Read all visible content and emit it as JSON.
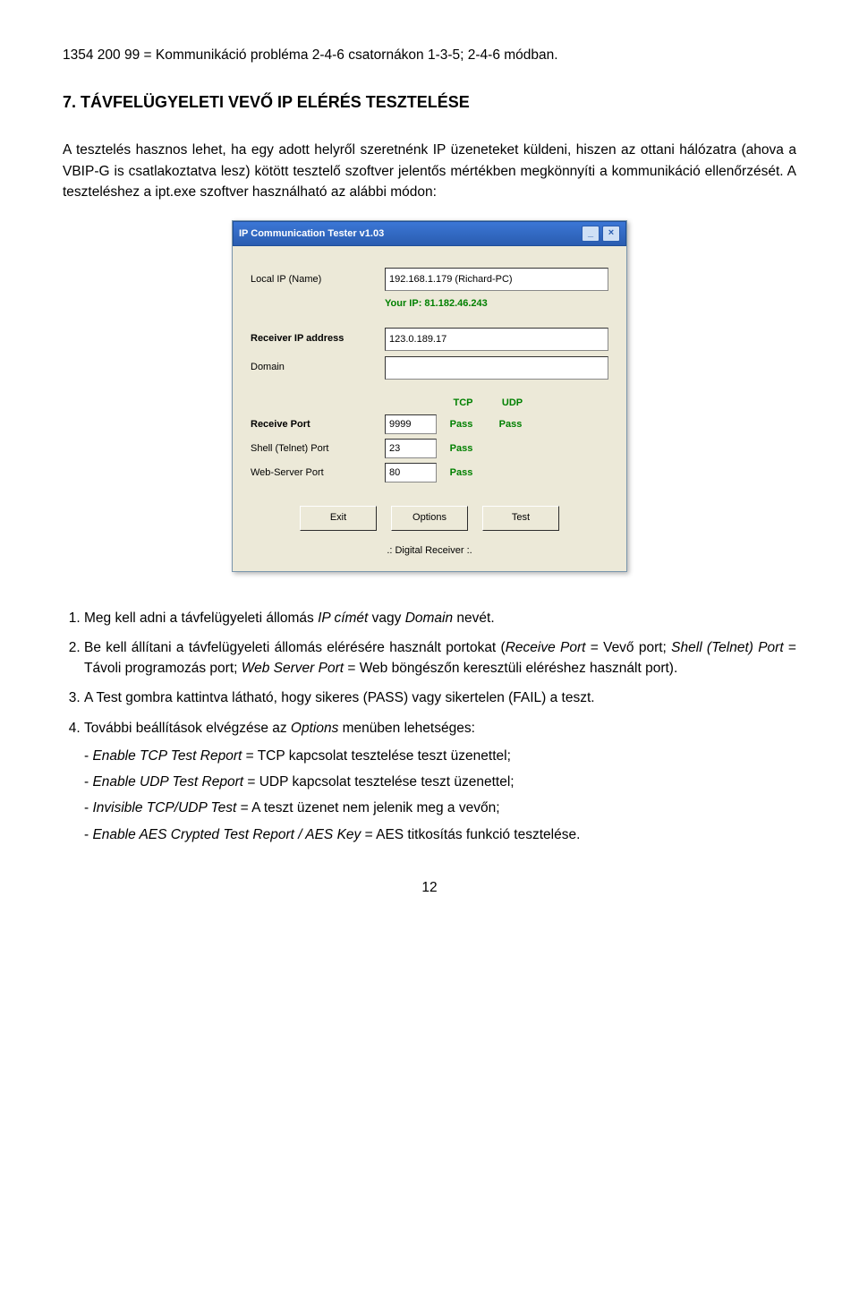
{
  "intro_line": "1354 200 99 = Kommunikáció probléma 2-4-6 csatornákon 1-3-5; 2-4-6 módban.",
  "section_heading": "7. TÁVFELÜGYELETI VEVŐ IP ELÉRÉS TESZTELÉSE",
  "paragraph": "A tesztelés hasznos lehet, ha egy adott helyről szeretnénk IP üzeneteket küldeni, hiszen az ottani hálózatra (ahova a VBIP-G is csatlakoztatva lesz) kötött tesztelő szoftver jelentős mértékben megkönnyíti a kommunikáció ellenőrzését. A teszteléshez a ipt.exe szoftver használható az alábbi módon:",
  "app": {
    "title": "IP Communication Tester v1.03",
    "local_ip_label": "Local IP (Name)",
    "local_ip_value": "192.168.1.179 (Richard-PC)",
    "your_ip_label": "Your IP:",
    "your_ip_value": "81.182.46.243",
    "receiver_ip_label": "Receiver IP address",
    "receiver_ip_value": "123.0.189.17",
    "domain_label": "Domain",
    "domain_value": "",
    "col_tcp": "TCP",
    "col_udp": "UDP",
    "receive_port_label": "Receive Port",
    "receive_port_value": "9999",
    "receive_tcp_result": "Pass",
    "receive_udp_result": "Pass",
    "shell_port_label": "Shell (Telnet) Port",
    "shell_port_value": "23",
    "shell_tcp_result": "Pass",
    "web_port_label": "Web-Server Port",
    "web_port_value": "80",
    "web_tcp_result": "Pass",
    "btn_exit": "Exit",
    "btn_options": "Options",
    "btn_test": "Test",
    "footer": ".: Digital Receiver :."
  },
  "list": {
    "item1_prefix": "Meg kell adni a távfelügyeleti állomás ",
    "item1_italic": "IP címét",
    "item1_mid": " vagy ",
    "item1_italic2": "Domain",
    "item1_suffix": " nevét.",
    "item2_prefix": "Be kell állítani a távfelügyeleti állomás elérésére használt portokat (",
    "item2_i1": "Receive Port",
    "item2_t2": " = Vevő port; ",
    "item2_i2": "Shell (Telnet) Port",
    "item2_t3": " = Távoli programozás port; ",
    "item2_i3": "Web Server Port",
    "item2_t4": " = Web böngészőn keresztüli eléréshez használt port).",
    "item3": "A Test gombra kattintva látható, hogy sikeres (PASS) vagy sikertelen (FAIL) a teszt.",
    "item4_prefix": "További beállítások elvégzése az ",
    "item4_italic": "Options",
    "item4_suffix": " menüben lehetséges:",
    "sub1_i": "Enable TCP Test Report",
    "sub1_t": " = TCP kapcsolat tesztelése teszt üzenettel;",
    "sub2_i": "Enable UDP Test Report",
    "sub2_t": " = UDP kapcsolat tesztelése teszt üzenettel;",
    "sub3_i": "Invisible TCP/UDP Test",
    "sub3_t": " = A teszt üzenet nem jelenik meg a vevőn;",
    "sub4_i": "Enable AES Crypted Test Report / AES Key",
    "sub4_t": " = AES titkosítás funkció tesztelése."
  },
  "page_number": "12"
}
